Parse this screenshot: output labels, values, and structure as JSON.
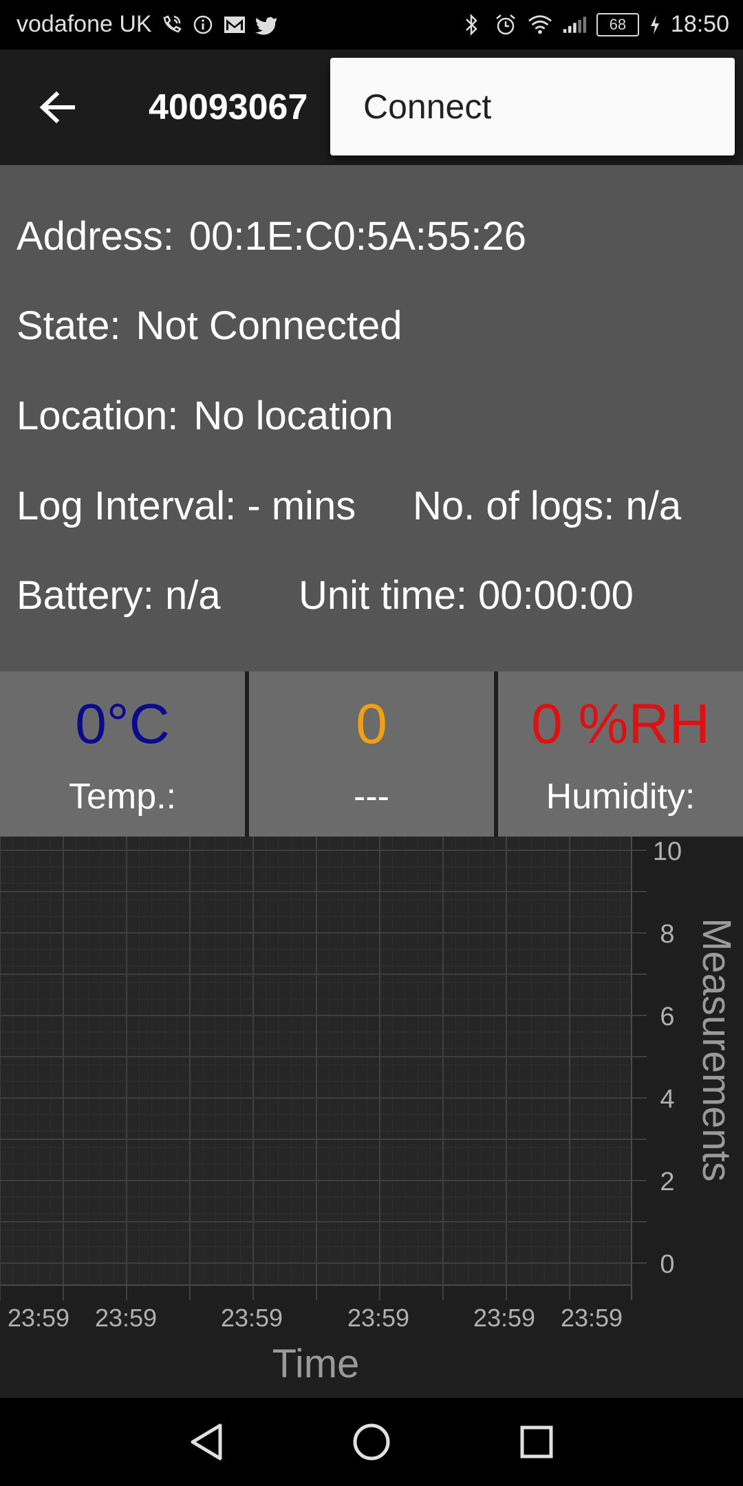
{
  "status_bar": {
    "carrier": "vodafone UK",
    "left_icons": [
      "wifi-calling-icon",
      "info-icon",
      "gmail-icon",
      "twitter-icon"
    ],
    "right_icons": [
      "bluetooth-icon",
      "alarm-icon",
      "wifi-icon",
      "signal-icon"
    ],
    "battery": "68",
    "time": "18:50"
  },
  "toolbar": {
    "title": "40093067",
    "back_icon": "arrow-back-icon"
  },
  "menu": {
    "items": [
      {
        "label": "Connect"
      }
    ]
  },
  "info": {
    "address_label": "Address:",
    "address_value": "00:1E:C0:5A:55:26",
    "state_label": "State:",
    "state_value": "Not Connected",
    "location_label": "Location:",
    "location_value": "No location",
    "log_interval": "Log Interval: - mins",
    "no_of_logs": "No. of logs: n/a",
    "battery": "Battery: n/a",
    "unit_time": "Unit time: 00:00:00"
  },
  "readings": [
    {
      "value": "0°C",
      "label": "Temp.:",
      "color": "#0a0a8c"
    },
    {
      "value": "0",
      "label": "---",
      "color": "#f0a010"
    },
    {
      "value": "0 %RH",
      "label": "Humidity:",
      "color": "#e01010"
    }
  ],
  "chart_data": {
    "type": "line",
    "xlabel": "Time",
    "ylabel": "Measurements",
    "x_ticks": [
      "23:59",
      "23:59",
      "23:59",
      "23:59",
      "23:59",
      "23:59"
    ],
    "y_ticks": [
      0,
      2,
      4,
      6,
      8,
      10
    ],
    "ylim": [
      0,
      10
    ],
    "series": [],
    "grid": true,
    "y_axis_side": "right"
  },
  "nav": {
    "back_icon": "nav-back-icon",
    "home_icon": "nav-home-icon",
    "recents_icon": "nav-recents-icon"
  }
}
